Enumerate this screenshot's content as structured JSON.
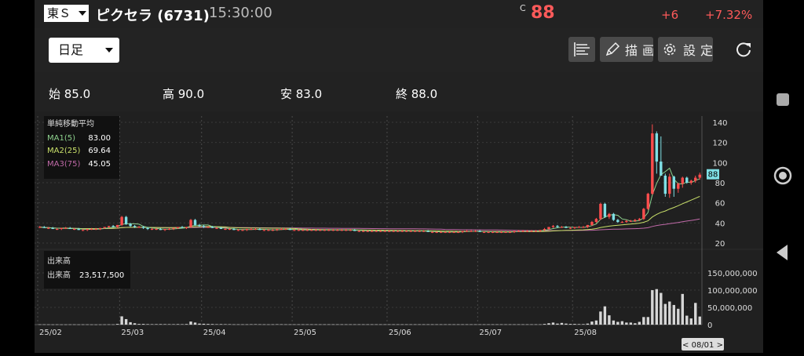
{
  "header": {
    "market": "東Ｓ",
    "stock_name": "ピクセラ (6731)",
    "time": "15:30:00",
    "close_marker": "C",
    "price": "88",
    "change": "+6",
    "change_pct": "+7.32%"
  },
  "toolbar": {
    "period": "日足",
    "draw_label": "描画",
    "settings_label": "設定"
  },
  "ohlc": {
    "open": "始 85.0",
    "high": "高 90.0",
    "low": "安 83.0",
    "close": "終 88.0"
  },
  "ma_legend": {
    "title": "単純移動平均",
    "ma1_label": "MA1(5)",
    "ma1_value": "83.00",
    "ma2_label": "MA2(25)",
    "ma2_value": "69.64",
    "ma3_label": "MA3(75)",
    "ma3_value": "45.05"
  },
  "volume_legend": {
    "title": "出来高",
    "label": "出来高",
    "value": "23,517,500"
  },
  "price_axis_labels": [
    "140",
    "120",
    "100",
    "80",
    "60",
    "40",
    "20"
  ],
  "volume_axis_labels": [
    "150,000,000",
    "100,000,000",
    "50,000,000",
    "0"
  ],
  "last_price_tag": "88",
  "date_labels": [
    "25/02",
    "25/03",
    "25/04",
    "25/05",
    "25/06",
    "25/07",
    "25/08"
  ],
  "cursor_date": "< 08/01 >",
  "colors": {
    "up": "#ff4d4d",
    "down": "#7fe0e6",
    "ma1": "#8dd18d",
    "ma2": "#c9e06a",
    "ma3": "#c06aa8",
    "price_red": "#ff5a5a"
  },
  "chart_data": {
    "type": "candlestick",
    "period": "daily",
    "ohlc": [
      [
        36,
        37,
        35,
        36
      ],
      [
        36,
        37,
        35,
        35
      ],
      [
        35,
        36,
        34,
        35
      ],
      [
        35,
        36,
        34,
        34
      ],
      [
        34,
        35,
        33,
        34
      ],
      [
        34,
        35,
        33,
        35
      ],
      [
        35,
        36,
        34,
        35
      ],
      [
        35,
        36,
        34,
        34
      ],
      [
        34,
        35,
        33,
        34
      ],
      [
        34,
        35,
        33,
        33
      ],
      [
        33,
        34,
        32,
        33
      ],
      [
        33,
        34,
        32,
        34
      ],
      [
        34,
        35,
        33,
        34
      ],
      [
        34,
        35,
        33,
        34
      ],
      [
        34,
        35,
        33,
        35
      ],
      [
        35,
        36,
        34,
        36
      ],
      [
        36,
        37,
        35,
        37
      ],
      [
        37,
        38,
        36,
        36
      ],
      [
        36,
        38,
        35,
        38
      ],
      [
        38,
        47,
        37,
        46
      ],
      [
        46,
        47,
        38,
        39
      ],
      [
        39,
        40,
        36,
        37
      ],
      [
        37,
        38,
        35,
        36
      ],
      [
        36,
        37,
        35,
        36
      ],
      [
        36,
        37,
        34,
        35
      ],
      [
        35,
        36,
        33,
        34
      ],
      [
        34,
        35,
        33,
        34
      ],
      [
        34,
        35,
        33,
        34
      ],
      [
        34,
        35,
        33,
        33
      ],
      [
        33,
        34,
        32,
        34
      ],
      [
        34,
        35,
        33,
        34
      ],
      [
        34,
        35,
        33,
        35
      ],
      [
        35,
        36,
        34,
        36
      ],
      [
        36,
        37,
        35,
        35
      ],
      [
        35,
        36,
        34,
        36
      ],
      [
        36,
        44,
        35,
        43
      ],
      [
        43,
        44,
        37,
        38
      ],
      [
        38,
        39,
        36,
        37
      ],
      [
        37,
        38,
        35,
        36
      ],
      [
        36,
        37,
        35,
        36
      ],
      [
        36,
        37,
        35,
        35
      ],
      [
        35,
        36,
        34,
        35
      ],
      [
        35,
        36,
        34,
        34
      ],
      [
        34,
        35,
        33,
        34
      ],
      [
        34,
        35,
        33,
        34
      ],
      [
        34,
        35,
        33,
        33
      ],
      [
        33,
        34,
        32,
        33
      ],
      [
        33,
        34,
        32,
        33
      ],
      [
        33,
        34,
        32,
        34
      ],
      [
        34,
        35,
        33,
        34
      ],
      [
        34,
        35,
        33,
        34
      ],
      [
        34,
        35,
        33,
        33
      ],
      [
        33,
        34,
        32,
        33
      ],
      [
        33,
        34,
        32,
        33
      ],
      [
        33,
        34,
        32,
        33
      ],
      [
        33,
        34,
        32,
        34
      ],
      [
        34,
        35,
        33,
        34
      ],
      [
        34,
        35,
        33,
        34
      ],
      [
        34,
        35,
        33,
        33
      ],
      [
        33,
        34,
        32,
        33
      ],
      [
        33,
        34,
        32,
        33
      ],
      [
        33,
        34,
        32,
        33
      ],
      [
        33,
        34,
        32,
        33
      ],
      [
        33,
        34,
        32,
        33
      ],
      [
        33,
        34,
        32,
        33
      ],
      [
        33,
        34,
        32,
        33
      ],
      [
        33,
        34,
        32,
        33
      ],
      [
        33,
        34,
        32,
        33
      ],
      [
        33,
        34,
        32,
        33
      ],
      [
        33,
        34,
        32,
        33
      ],
      [
        33,
        34,
        32,
        33
      ],
      [
        33,
        34,
        32,
        33
      ],
      [
        33,
        34,
        32,
        33
      ],
      [
        33,
        34,
        32,
        32
      ],
      [
        32,
        33,
        31,
        32
      ],
      [
        32,
        33,
        31,
        32
      ],
      [
        32,
        33,
        31,
        32
      ],
      [
        32,
        33,
        31,
        32
      ],
      [
        32,
        33,
        31,
        32
      ],
      [
        32,
        33,
        31,
        32
      ],
      [
        32,
        33,
        31,
        32
      ],
      [
        32,
        33,
        31,
        32
      ],
      [
        32,
        33,
        31,
        32
      ],
      [
        32,
        33,
        31,
        32
      ],
      [
        32,
        33,
        31,
        32
      ],
      [
        32,
        33,
        31,
        32
      ],
      [
        32,
        33,
        31,
        32
      ],
      [
        32,
        33,
        31,
        32
      ],
      [
        32,
        33,
        31,
        32
      ],
      [
        32,
        33,
        31,
        32
      ],
      [
        32,
        33,
        31,
        31
      ],
      [
        31,
        32,
        30,
        31
      ],
      [
        31,
        32,
        30,
        31
      ],
      [
        31,
        32,
        30,
        31
      ],
      [
        31,
        32,
        30,
        31
      ],
      [
        31,
        32,
        30,
        31
      ],
      [
        31,
        32,
        30,
        31
      ],
      [
        31,
        32,
        30,
        31
      ],
      [
        31,
        32,
        30,
        32
      ],
      [
        32,
        33,
        31,
        32
      ],
      [
        32,
        33,
        31,
        32
      ],
      [
        32,
        33,
        31,
        32
      ],
      [
        32,
        33,
        31,
        31
      ],
      [
        31,
        32,
        30,
        31
      ],
      [
        31,
        32,
        30,
        31
      ],
      [
        31,
        32,
        30,
        31
      ],
      [
        31,
        32,
        30,
        31
      ],
      [
        31,
        32,
        30,
        31
      ],
      [
        31,
        32,
        30,
        31
      ],
      [
        31,
        32,
        30,
        31
      ],
      [
        31,
        32,
        30,
        32
      ],
      [
        32,
        33,
        31,
        32
      ],
      [
        32,
        33,
        31,
        32
      ],
      [
        32,
        33,
        31,
        32
      ],
      [
        32,
        33,
        31,
        32
      ],
      [
        32,
        33,
        31,
        32
      ],
      [
        32,
        33,
        31,
        33
      ],
      [
        33,
        35,
        32,
        34
      ],
      [
        34,
        36,
        33,
        36
      ],
      [
        36,
        38,
        35,
        37
      ],
      [
        37,
        38,
        35,
        36
      ],
      [
        36,
        37,
        35,
        36
      ],
      [
        36,
        37,
        35,
        35
      ],
      [
        35,
        36,
        34,
        35
      ],
      [
        35,
        36,
        34,
        36
      ],
      [
        36,
        37,
        35,
        36
      ],
      [
        36,
        37,
        35,
        36
      ],
      [
        36,
        38,
        35,
        38
      ],
      [
        38,
        42,
        37,
        41
      ],
      [
        41,
        45,
        40,
        44
      ],
      [
        44,
        60,
        43,
        59
      ],
      [
        59,
        60,
        45,
        46
      ],
      [
        46,
        50,
        44,
        49
      ],
      [
        49,
        50,
        42,
        43
      ],
      [
        43,
        44,
        40,
        41
      ],
      [
        41,
        42,
        40,
        41
      ],
      [
        41,
        43,
        40,
        42
      ],
      [
        42,
        43,
        41,
        42
      ],
      [
        42,
        44,
        41,
        43
      ],
      [
        43,
        45,
        42,
        44
      ],
      [
        44,
        55,
        43,
        54
      ],
      [
        54,
        70,
        53,
        69
      ],
      [
        69,
        138,
        68,
        129
      ],
      [
        129,
        131,
        89,
        101
      ],
      [
        101,
        126,
        88,
        87
      ],
      [
        87,
        89,
        66,
        69
      ],
      [
        69,
        89,
        65,
        86
      ],
      [
        86,
        87,
        66,
        74
      ],
      [
        74,
        80,
        70,
        79
      ],
      [
        79,
        86,
        75,
        85
      ],
      [
        85,
        86,
        79,
        80
      ],
      [
        80,
        83,
        78,
        82
      ],
      [
        82,
        87,
        80,
        85
      ],
      [
        85,
        90,
        83,
        88
      ]
    ],
    "volume": [
      0.7,
      0.7,
      0.6,
      0.5,
      0.6,
      0.5,
      0.5,
      0.6,
      0.6,
      0.5,
      0.6,
      0.6,
      0.5,
      0.4,
      0.5,
      0.6,
      0.7,
      0.6,
      2.0,
      24,
      16,
      7,
      4,
      2,
      2,
      1.4,
      1.2,
      1.3,
      1.4,
      1.3,
      1.2,
      1.2,
      1.4,
      1.2,
      1.6,
      9,
      6,
      3,
      2.5,
      2,
      1.6,
      1.2,
      1.4,
      1.2,
      1.1,
      0.8,
      0.8,
      0.8,
      0.8,
      1.0,
      1.1,
      0.9,
      0.8,
      0.7,
      0.8,
      1.0,
      0.9,
      0.8,
      0.8,
      0.8,
      0.8,
      0.8,
      0.8,
      0.8,
      0.8,
      0.8,
      0.8,
      0.8,
      0.8,
      0.8,
      0.8,
      0.8,
      0.8,
      0.8,
      0.8,
      0.8,
      0.8,
      0.8,
      0.8,
      0.8,
      0.8,
      0.8,
      0.8,
      0.8,
      0.8,
      0.8,
      0.8,
      0.8,
      0.8,
      0.8,
      0.8,
      0.8,
      0.8,
      0.8,
      0.8,
      0.8,
      0.8,
      0.8,
      0.8,
      0.8,
      0.8,
      0.8,
      0.8,
      0.8,
      0.8,
      0.8,
      0.8,
      0.8,
      0.8,
      0.8,
      0.8,
      0.8,
      0.8,
      0.8,
      0.8,
      0.8,
      0.8,
      2,
      4,
      6,
      3,
      5,
      3,
      2,
      2,
      1.5,
      1.5,
      3,
      9,
      12,
      38,
      53,
      27,
      12,
      8,
      10,
      6,
      6,
      4,
      8,
      22,
      22,
      100,
      103,
      92,
      60,
      67,
      57,
      46,
      89,
      26,
      18,
      63,
      23.5
    ],
    "volume_unit": "millions",
    "ma_periods": [
      5,
      25,
      75
    ],
    "y_range": [
      20,
      140
    ],
    "y_ticks": [
      20,
      40,
      60,
      80,
      100,
      120,
      140
    ],
    "volume_range_millions": [
      0,
      150
    ],
    "x_date_labels": [
      "25/02",
      "25/03",
      "25/04",
      "25/05",
      "25/06",
      "25/07",
      "25/08"
    ],
    "last_close": 88
  }
}
